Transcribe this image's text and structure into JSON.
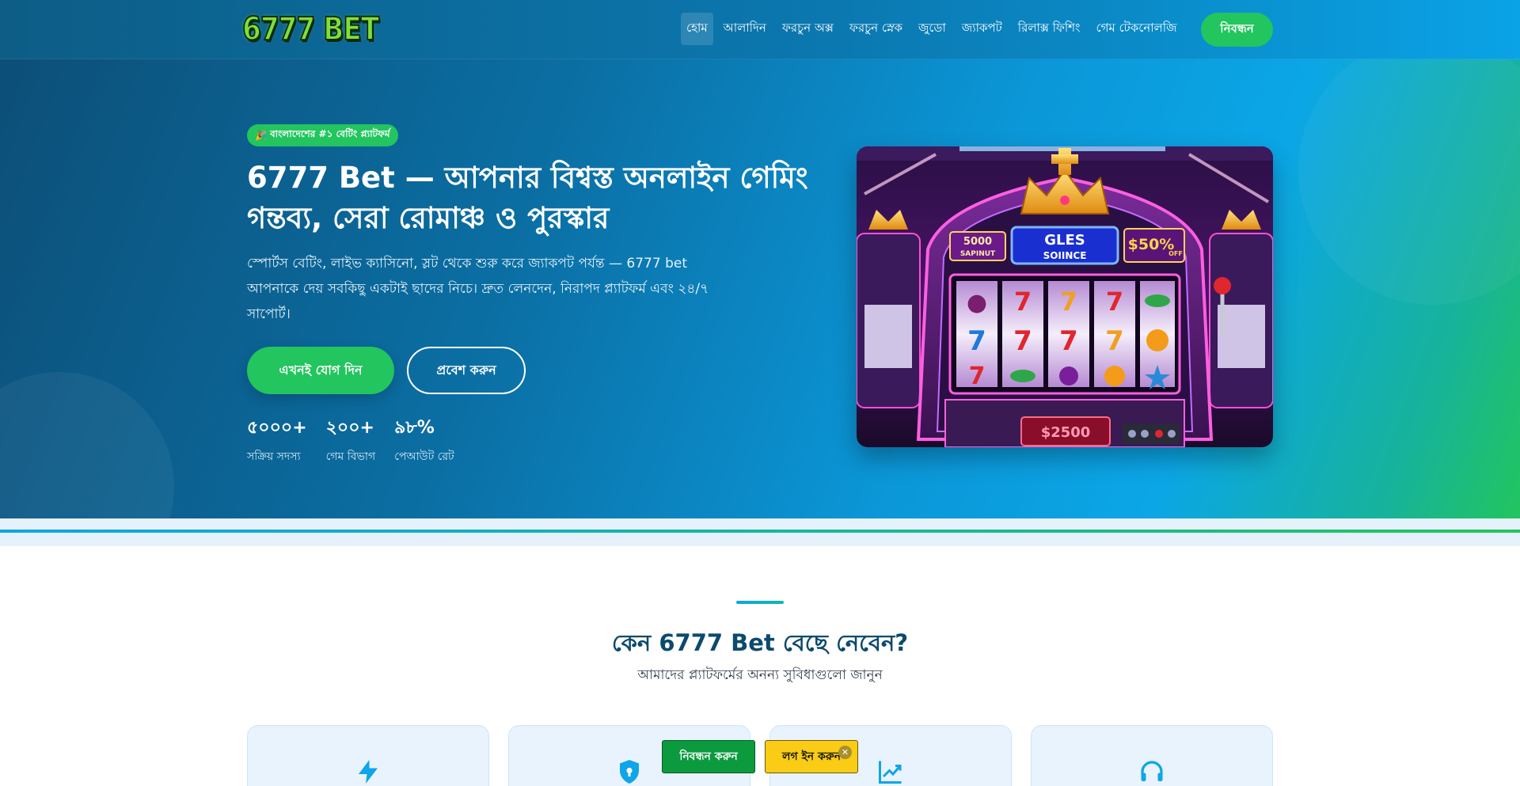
{
  "header": {
    "logo_text": "6777 BET",
    "nav": [
      "হোম",
      "আলাদিন",
      "ফরচুন অক্স",
      "ফরচুন স্নেক",
      "জুডো",
      "জ্যাকপট",
      "রিলাক্স ফিশিং",
      "গেম টেকনোলজি"
    ],
    "register_label": "নিবন্ধন"
  },
  "hero": {
    "badge_icon": "🎉",
    "badge": "বাংলাদেশের #১ বেটিং প্ল্যাটফর্ম",
    "title": "6777 Bet — আপনার বিশ্বস্ত অনলাইন গেমিং গন্তব্য, সেরা রোমাঞ্চ ও পুরস্কার",
    "description": "স্পোর্টস বেটিং, লাইভ ক্যাসিনো, স্লট থেকে শুরু করে জ্যাকপট পর্যন্ত — 6777 bet আপনাকে দেয় সবকিছু একটাই ছাদের নিচে। দ্রুত লেনদেন, নিরাপদ প্ল্যাটফর্ম এবং ২৪/৭ সাপোর্ট।",
    "join_label": "এখনই যোগ দিন",
    "enter_label": "প্রবেশ করুন",
    "stats": [
      {
        "value": "৫০০০+",
        "label": "সক্রিয় সদস্য"
      },
      {
        "value": "২০০+",
        "label": "গেম বিভাগ"
      },
      {
        "value": "৯৮%",
        "label": "পেআউট রেট"
      }
    ],
    "image": {
      "sign_left_top": "5000",
      "sign_left_bottom": "SAPINUT",
      "sign_center_top": "GLES",
      "sign_center_bottom": "SOIINCE",
      "sign_right_big": "$50%",
      "sign_right_small": "OFF",
      "jackpot": "$2500"
    }
  },
  "why": {
    "title": "কেন 6777 Bet বেছে নেবেন?",
    "subtitle": "আমাদের প্ল্যাটফর্মের অনন্য সুবিধাগুলো জানুন",
    "cards": [
      {
        "icon": "lightning-icon"
      },
      {
        "icon": "shield-lock-icon"
      },
      {
        "icon": "trend-up-icon"
      },
      {
        "icon": "headset-icon"
      }
    ]
  },
  "floating_cta": {
    "register_label": "নিবন্ধন করুন",
    "login_label": "লগ ইন করুন",
    "close_glyph": "✕"
  },
  "colors": {
    "accent_green": "#22c55e",
    "brand_blue": "#0b78b0",
    "login_yellow": "#facc15"
  }
}
